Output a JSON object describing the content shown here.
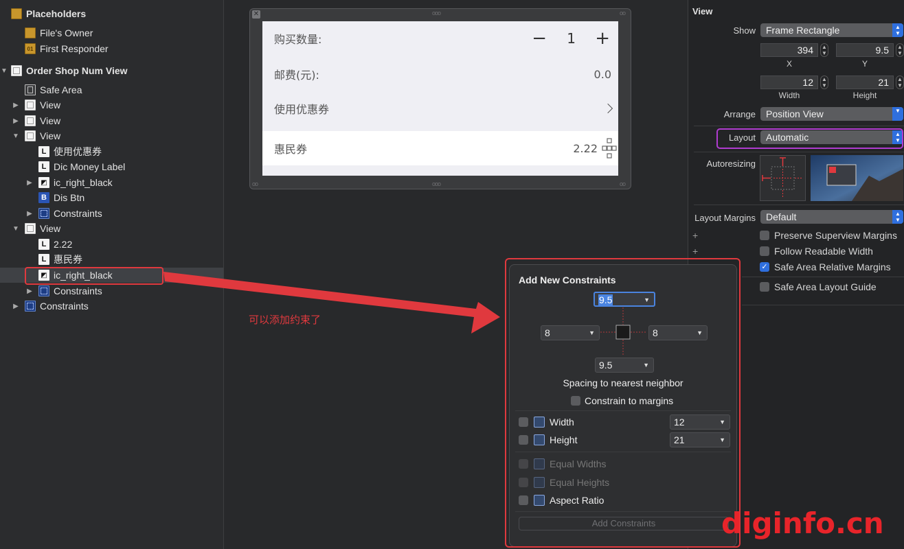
{
  "outline": {
    "placeholders_label": "Placeholders",
    "files_owner": "File's Owner",
    "first_responder": "First Responder",
    "root_view": "Order Shop Num View",
    "items": {
      "safe_area": "Safe Area",
      "view1": "View",
      "view2": "View",
      "view3": "View",
      "coupon_label": "使用优惠券",
      "dic_money_label": "Dic Money Label",
      "ic_right_black_1": "ic_right_black",
      "dis_btn": "Dis Btn",
      "constraints_1": "Constraints",
      "view4": "View",
      "value_label": "2.22",
      "voucher_label": "惠民券",
      "ic_right_black_2": "ic_right_black",
      "constraints_2": "Constraints",
      "constraints_3": "Constraints"
    },
    "icon_letters": {
      "label": "L",
      "button": "B",
      "first_responder": "01"
    }
  },
  "device": {
    "qty_label": "购买数量:",
    "qty_minus": "−",
    "qty_value": "1",
    "qty_plus": "+",
    "postage_label": "邮费(元):",
    "postage_value": "0.0",
    "coupon_label": "使用优惠券",
    "voucher_label": "惠民券",
    "voucher_value": "2.22"
  },
  "annotation": {
    "text": "可以添加约束了"
  },
  "inspector": {
    "section": "View",
    "show_label": "Show",
    "show_value": "Frame Rectangle",
    "x_value": "394",
    "y_value": "9.5",
    "x_caption": "X",
    "y_caption": "Y",
    "width_value": "12",
    "height_value": "21",
    "width_caption": "Width",
    "height_caption": "Height",
    "arrange_label": "Arrange",
    "arrange_value": "Position View",
    "layout_label": "Layout",
    "layout_value": "Automatic",
    "autoresizing_label": "Autoresizing",
    "margins_label": "Layout Margins",
    "margins_value": "Default",
    "checkboxes": [
      {
        "label": "Preserve Superview Margins",
        "checked": false
      },
      {
        "label": "Follow Readable Width",
        "checked": false
      },
      {
        "label": "Safe Area Relative Margins",
        "checked": true
      },
      {
        "label": "Safe Area Layout Guide",
        "checked": false
      }
    ],
    "colors": {
      "accent": "#2f6fde",
      "highlight": "#b03cd0"
    }
  },
  "popover": {
    "title": "Add New Constraints",
    "top_value": "9.5",
    "left_value": "8",
    "right_value": "8",
    "bottom_value": "9.5",
    "spacing_caption": "Spacing to nearest neighbor",
    "constrain_margins": "Constrain to margins",
    "width_label": "Width",
    "width_value": "12",
    "height_label": "Height",
    "height_value": "21",
    "equal_widths": "Equal Widths",
    "equal_heights": "Equal Heights",
    "aspect_ratio": "Aspect Ratio",
    "add_button": "Add Constraints",
    "colors": {
      "annotation": "#e0393e"
    }
  },
  "watermark": "diginfo.cn"
}
